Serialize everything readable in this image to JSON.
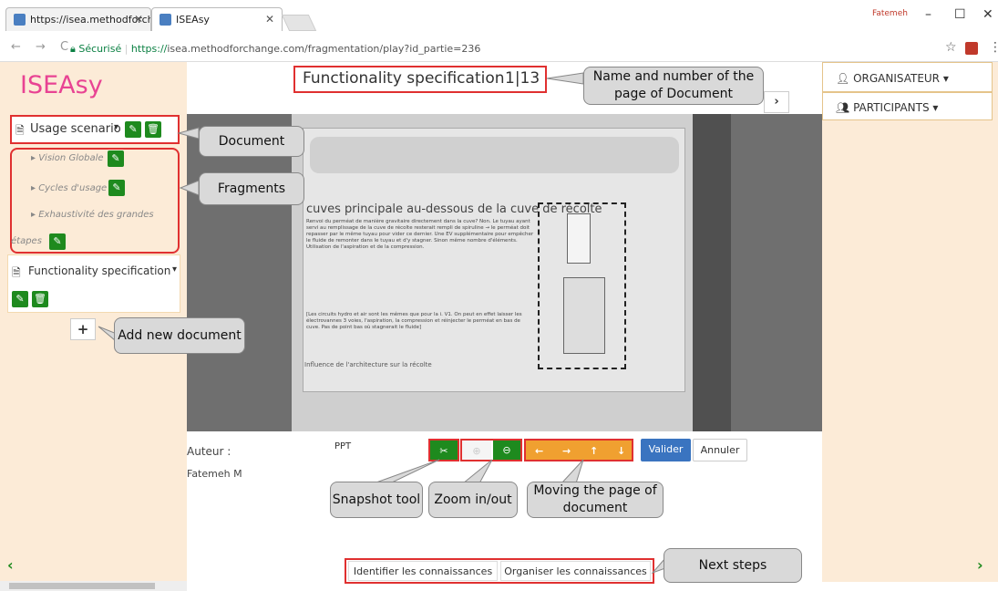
{
  "browser": {
    "tabs": [
      {
        "title": "https://isea.methodforch"
      },
      {
        "title": "ISEAsy"
      }
    ],
    "user": "Fatemeh",
    "window_controls": [
      "–",
      "☐",
      "✕"
    ],
    "nav_icons": "← → C",
    "secure_label": "Sécurisé",
    "url_scheme": "https://",
    "url_rest": "isea.methodforchange.com/fragmentation/play?id_partie=236"
  },
  "app": {
    "logo": "ISEAsy",
    "page_title": "Functionality specification",
    "page_counter": "1|13",
    "next_page": "›"
  },
  "sidebar": {
    "doc1": {
      "label": "Usage scenario"
    },
    "fragments": [
      {
        "label": "Vision Globale"
      },
      {
        "label": "Cycles d'usage"
      },
      {
        "label": "Exhaustivité des grandes"
      },
      {
        "label": "étapes"
      }
    ],
    "doc2": {
      "label": "Functionality specification"
    },
    "add_button": "+",
    "prev_arrow": "‹"
  },
  "viewer": {
    "heading": "cuves principale au-dessous de la cuve de récolte",
    "text1": "Renvoi du perméat de manière gravitaire directement dans la cuve? Non. Le tuyau ayant servi au remplissage de la cuve de récolte resterait rempli de spiruline → le perméat doit repasser par le même tuyau pour vider ce dernier. Une EV supplémentaire pour empêcher le fluide de remonter dans le tuyau et d'y stagner. Sinon même nombre d'éléments. Utilisation de l'aspiration et de la compression.",
    "text2": "[Les circuits hydro et air sont les mêmes que pour la i. V1. On peut en effet laisser les électrovannes 3 voies, l'aspiration, la compression et réinjecter le perméat en bas de cuve. Pas de point bas où stagnerait le fluide]",
    "caption": "Influence de l'architecture sur la récolte"
  },
  "bottom": {
    "auteur_label": "Auteur :",
    "author_name": "Fatemeh M",
    "ppt": "PPT",
    "snapshot_icon": "✂",
    "zoom_in": "⊕",
    "zoom_out": "⊖",
    "arrows": [
      "←",
      "→",
      "↑",
      "↓"
    ],
    "valider": "Valider",
    "annuler": "Annuler",
    "step1": "Identifier les connaissances",
    "step2": "Organiser les connaissances",
    "next_arrow": "›"
  },
  "right": {
    "organisateur": "ORGANISATEUR",
    "participants": "PARTICIPANTS"
  },
  "callouts": {
    "name_number": "Name and number of the page of Document",
    "document": "Document",
    "fragments": "Fragments",
    "add_new": "Add new document",
    "snapshot": "Snapshot tool",
    "zoom": "Zoom in/out",
    "moving": "Moving the page of document",
    "next_steps": "Next steps"
  },
  "colors": {
    "accent_pink": "#e84393",
    "green": "#1e8a1e",
    "orange": "#f0a030",
    "blue": "#3a74c0",
    "panel": "#fcebd7",
    "annotation_red": "#e03030"
  }
}
